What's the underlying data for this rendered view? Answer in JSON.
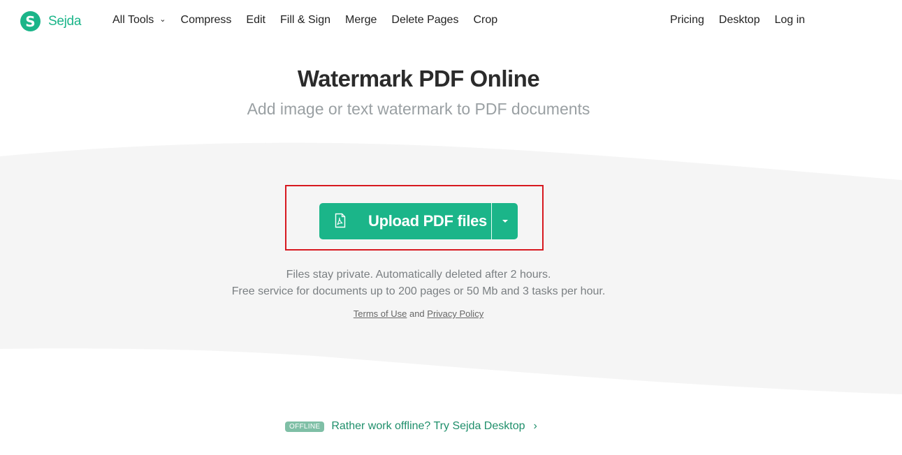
{
  "header": {
    "logo_letter": "S",
    "brand": "Sejda",
    "nav": [
      {
        "label": "All Tools",
        "has_dropdown": true
      },
      {
        "label": "Compress"
      },
      {
        "label": "Edit"
      },
      {
        "label": "Fill & Sign"
      },
      {
        "label": "Merge"
      },
      {
        "label": "Delete Pages"
      },
      {
        "label": "Crop"
      }
    ],
    "nav_right": [
      {
        "label": "Pricing"
      },
      {
        "label": "Desktop"
      },
      {
        "label": "Log in"
      }
    ],
    "chevron": "⌄"
  },
  "main": {
    "title": "Watermark PDF Online",
    "subtitle": "Add image or text watermark to PDF documents",
    "upload_label": "Upload PDF files",
    "info_line1": "Files stay private. Automatically deleted after 2 hours.",
    "info_line2": "Free service for documents up to 200 pages or 50 Mb and 3 tasks per hour.",
    "terms": "Terms of Use",
    "and": " and ",
    "privacy": "Privacy Policy"
  },
  "offline": {
    "badge": "OFFLINE",
    "text": "Rather work offline? Try Sejda Desktop",
    "arrow": "›"
  },
  "colors": {
    "brand": "#1bb589",
    "highlight": "#d71920",
    "band": "#f5f5f5"
  }
}
